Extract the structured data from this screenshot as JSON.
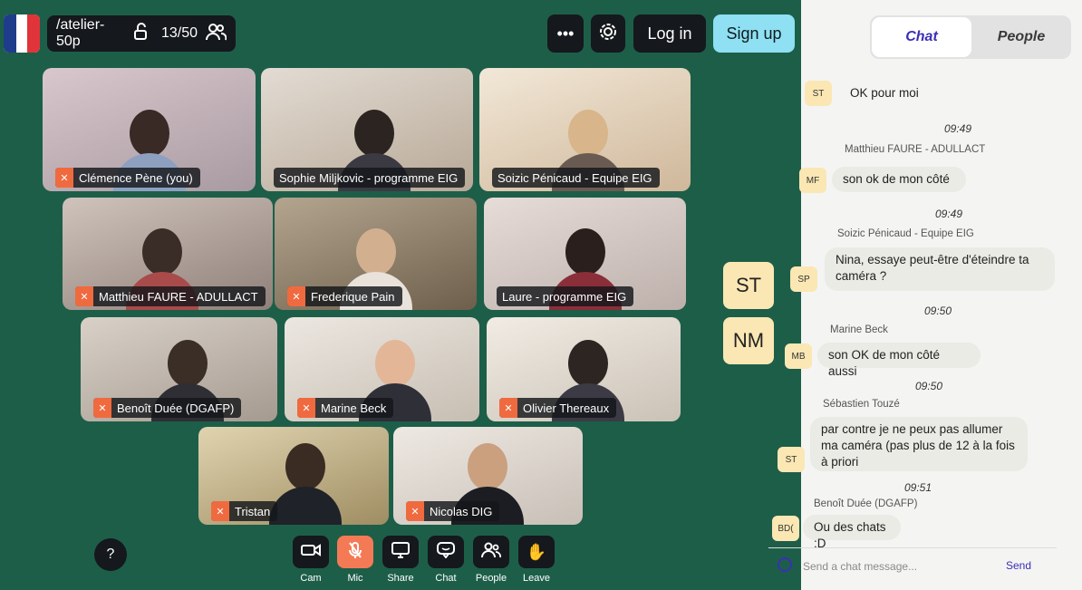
{
  "header": {
    "room": "/atelier-50p",
    "count": "13/50",
    "login": "Log in",
    "signup": "Sign up"
  },
  "participants": [
    "Clémence Pène (you)",
    "Sophie Miljkovic - programme EIG",
    "Soizic Pénicaud - Equipe EIG",
    "Matthieu FAURE - ADULLACT",
    "Frederique Pain",
    "Laure - programme EIG",
    "Benoît Duée (DGAFP)",
    "Marine Beck",
    "Olivier Thereaux",
    "Tristan",
    "Nicolas DIG"
  ],
  "side_avatars": [
    "ST",
    "NM"
  ],
  "controls": {
    "cam": "Cam",
    "mic": "Mic",
    "share": "Share",
    "chat": "Chat",
    "people": "People",
    "leave": "Leave",
    "help": "?"
  },
  "panel": {
    "tab_chat": "Chat",
    "tab_people": "People"
  },
  "chat": {
    "m0": {
      "initials": "ST",
      "text": "OK pour moi"
    },
    "m1": {
      "time": "09:49",
      "author": "Matthieu FAURE - ADULLACT",
      "initials": "MF",
      "text": "son ok de mon côté"
    },
    "m2": {
      "time": "09:49",
      "author": "Soizic Pénicaud - Equipe EIG",
      "initials": "SP",
      "text": "Nina, essaye peut-être d'éteindre ta caméra ?"
    },
    "m3": {
      "time": "09:50",
      "author": "Marine Beck",
      "initials": "MB",
      "text": "son OK de mon côté aussi"
    },
    "m4": {
      "time": "09:50",
      "author": "Sébastien Touzé",
      "initials": "ST",
      "text": "par contre je ne peux pas allumer ma caméra (pas plus de 12 à la fois à priori"
    },
    "m5": {
      "time": "09:51",
      "author": "Benoît Duée (DGAFP)",
      "initials": "BD(",
      "text": "Ou des chats :D"
    }
  },
  "composer": {
    "placeholder": "Send a chat message...",
    "send": "Send"
  }
}
